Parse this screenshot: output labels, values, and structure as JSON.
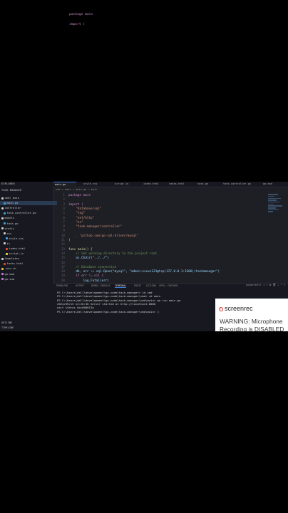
{
  "top_code": [
    "package main",
    "import ("
  ],
  "sidebar": {
    "explorer_title": "EXPLORER",
    "project_title": "TASK-MANAGER",
    "items": [
      {
        "label": "cmd\\ main",
        "selected": false,
        "icon": "folder-icon",
        "color": "#cfcfcf"
      },
      {
        "label": "main.go",
        "selected": true,
        "icon": "go-file-icon",
        "color": "#3fa3d8"
      },
      {
        "label": "controller",
        "selected": false,
        "icon": "folder-icon",
        "color": "#cfcfcf"
      },
      {
        "label": "task-controller.go",
        "selected": false,
        "icon": "go-file-icon",
        "color": "#3fa3d8"
      },
      {
        "label": "models",
        "selected": false,
        "icon": "folder-icon",
        "color": "#cfcfcf"
      },
      {
        "label": "task.go",
        "selected": false,
        "icon": "go-file-icon",
        "color": "#3fa3d8"
      },
      {
        "label": "static",
        "selected": false,
        "icon": "folder-icon",
        "color": "#cfcfcf"
      },
      {
        "label": "css",
        "selected": false,
        "icon": "folder-icon",
        "color": "#cfcfcf"
      },
      {
        "label": "style.css",
        "selected": false,
        "icon": "css-file-icon",
        "color": "#42a5f5"
      },
      {
        "label": "js",
        "selected": false,
        "icon": "folder-icon",
        "color": "#cfcfcf"
      },
      {
        "label": "index.html",
        "selected": false,
        "icon": "html-file-icon",
        "color": "#e44d26"
      },
      {
        "label": "script.js",
        "selected": false,
        "icon": "js-file-icon",
        "color": "#f1d94b"
      },
      {
        "label": "templates",
        "selected": false,
        "icon": "folder-icon",
        "color": "#cfcfcf"
      },
      {
        "label": "tasks.html",
        "selected": false,
        "icon": "html-file-icon",
        "color": "#e44d26"
      },
      {
        "label": ".env.ch",
        "selected": false,
        "icon": "env-file-icon",
        "color": "#e0c050"
      },
      {
        "label": "go.mod",
        "selected": false,
        "icon": "go-mod-icon",
        "color": "#c678dd"
      },
      {
        "label": "go.sum",
        "selected": false,
        "icon": "go-mod-icon",
        "color": "#c678dd"
      }
    ],
    "outline_label": "OUTLINE",
    "timeline_label": "TIMELINE"
  },
  "tabs": [
    "main.go",
    "style.css",
    "script.js",
    "index.html",
    "tasks.html",
    "task.go",
    "task-controller.go",
    "go.mod"
  ],
  "breadcrumb": "cmd > main > main.go > main",
  "code_lines": [
    {
      "n": "1",
      "text": "package main",
      "color": "#c586c0"
    },
    {
      "n": "2",
      "text": "",
      "color": "#d4d4d4"
    },
    {
      "n": "3",
      "text": "import (",
      "color": "#c586c0"
    },
    {
      "n": "4",
      "text": "    \"database/sql\"",
      "color": "#ce9178"
    },
    {
      "n": "5",
      "text": "    \"log\"",
      "color": "#ce9178"
    },
    {
      "n": "6",
      "text": "    \"net/http\"",
      "color": "#ce9178"
    },
    {
      "n": "7",
      "text": "    \"os\"",
      "color": "#ce9178"
    },
    {
      "n": "8",
      "text": "    \"task-manager/controller\"",
      "color": "#ce9178"
    },
    {
      "n": "9",
      "text": "",
      "color": "#d4d4d4"
    },
    {
      "n": "10",
      "text": "    _ \"github.com/go-sql-driver/mysql\"",
      "color": "#ce9178"
    },
    {
      "n": "11",
      "text": ")",
      "color": "#d4d4d4"
    },
    {
      "n": "12",
      "text": "",
      "color": "#d4d4d4"
    },
    {
      "n": "13",
      "text": "func main() {",
      "color": "#dcdcaa"
    },
    {
      "n": "14",
      "text": "    // Set working directory to the project root",
      "color": "#6a9955"
    },
    {
      "n": "15",
      "text": "    os.Chdir(\"../../\")",
      "color": "#9cdcfe"
    },
    {
      "n": "16",
      "text": "",
      "color": "#d4d4d4"
    },
    {
      "n": "17",
      "text": "    // Database connection",
      "color": "#6a9955"
    },
    {
      "n": "18",
      "text": "    db, err := sql.Open(\"mysql\", \"admin:sxxxx123@tcp(127.0.0.1:3306)/taskmanager\")",
      "color": "#9cdcfe"
    },
    {
      "n": "19",
      "text": "    if err != nil {",
      "color": "#c586c0"
    },
    {
      "n": "20",
      "text": "        log.Fatal(err)",
      "color": "#9cdcfe"
    }
  ],
  "panel": {
    "tabs": [
      "PROBLEMS",
      "OUTPUT",
      "DEBUG CONSOLE",
      "TERMINAL",
      "PORTS",
      "GITLENS",
      "SPELL CHECKER"
    ],
    "active_tab": "TERMINAL",
    "tools": "powershell  +  ▾  ⧉  🗑  …  ^  ✕",
    "lines": [
      "PS C:\\Users\\dell\\development\\go-code\\task-manager> cd cmd",
      "PS C:\\Users\\dell\\development\\go-code\\task-manager\\cmd> cd main",
      "PS C:\\Users\\dell\\development\\go-code\\task-manager\\cmd\\main> go run main.go",
      "2024/09/15 12:26:58 Server started at http://localhost:8080",
      "exit status 0xc000013a",
      "PS C:\\Users\\dell\\development\\go-code\\task-manager\\cmd\\main> ▯"
    ]
  },
  "screenrec": {
    "logo": "screenrec",
    "warning_line1": "WARNING: Microphone",
    "warning_line2": "Recording is DISABLED"
  }
}
